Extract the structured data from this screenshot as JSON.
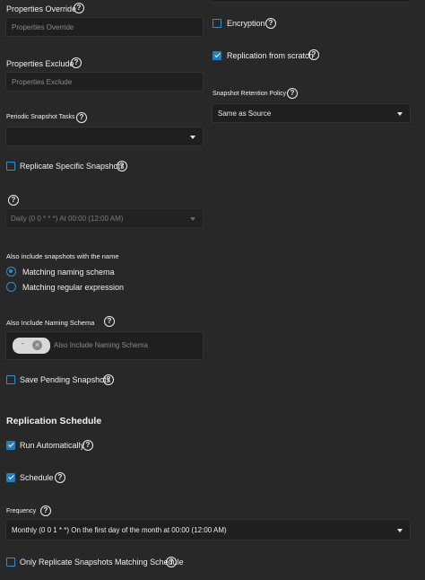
{
  "left": {
    "properties_override": {
      "label": "Properties Override",
      "placeholder": "Properties Override"
    },
    "properties_exclude": {
      "label": "Properties Exclude",
      "placeholder": "Properties Exclude"
    },
    "periodic_snapshot_tasks": {
      "label": "Periodic Snapshot Tasks",
      "value": ""
    },
    "replicate_specific_snapshots": {
      "label": "Replicate Specific Snapshots",
      "checked": false
    },
    "snapshot_schedule": {
      "value": "Daily (0 0 * * *)  At 00:00 (12:00 AM)"
    },
    "include_name": {
      "label": "Also include snapshots with the name",
      "options": [
        {
          "label": "Matching naming schema",
          "selected": true
        },
        {
          "label": "Matching regular expression",
          "selected": false
        }
      ]
    },
    "naming_schema": {
      "label": "Also Include Naming Schema",
      "chip_text": "-",
      "placeholder": "Also Include Naming Schema"
    },
    "save_pending": {
      "label": "Save Pending Snapshots",
      "checked": false
    }
  },
  "right": {
    "encryption": {
      "label": "Encryption",
      "checked": false
    },
    "replication_from_scratch": {
      "label": "Replication from scratch",
      "checked": true
    },
    "retention_policy": {
      "label": "Snapshot Retention Policy",
      "value": "Same as Source"
    }
  },
  "schedule": {
    "heading": "Replication Schedule",
    "run_automatically": {
      "label": "Run Automatically",
      "checked": true
    },
    "schedule": {
      "label": "Schedule",
      "checked": true
    },
    "frequency": {
      "label": "Frequency",
      "value": "Monthly (0 0 1 * *)  On the first day of the month at 00:00 (12:00 AM)"
    },
    "only_matching": {
      "label": "Only Replicate Snapshots Matching Schedule",
      "checked": false
    }
  },
  "icons": {
    "help": "?",
    "close": "×"
  },
  "colors": {
    "background": "#282828",
    "field": "#1f1f1f",
    "accent": "#1f7fc2"
  }
}
